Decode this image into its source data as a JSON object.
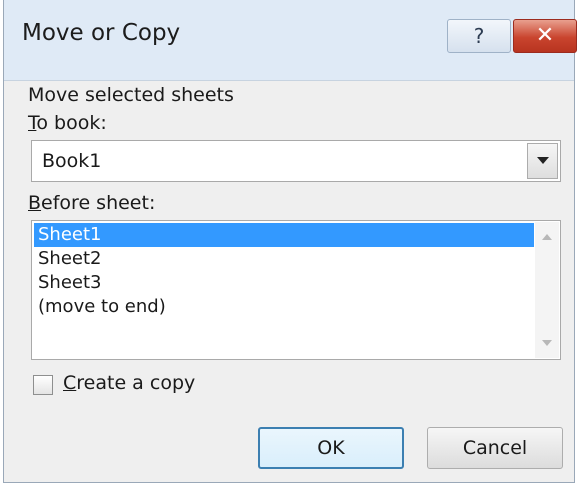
{
  "dialog": {
    "title": "Move or Copy",
    "help_glyph": "?",
    "close_glyph": "✕"
  },
  "move_label": "Move selected sheets",
  "to_book": {
    "label_prefix": "T",
    "label_rest": "o book:",
    "value": "Book1"
  },
  "before_sheet": {
    "label_prefix": "B",
    "label_rest": "efore sheet:",
    "items": [
      "Sheet1",
      "Sheet2",
      "Sheet3",
      "(move to end)"
    ],
    "selected": "Sheet1"
  },
  "copy": {
    "label_prefix": "C",
    "label_rest": "reate a copy",
    "checked": false
  },
  "buttons": {
    "ok": "OK",
    "cancel": "Cancel"
  },
  "colors": {
    "selection": "#3399ff",
    "titlebar": "#dfeaf6",
    "close_button": "#c9442e"
  }
}
